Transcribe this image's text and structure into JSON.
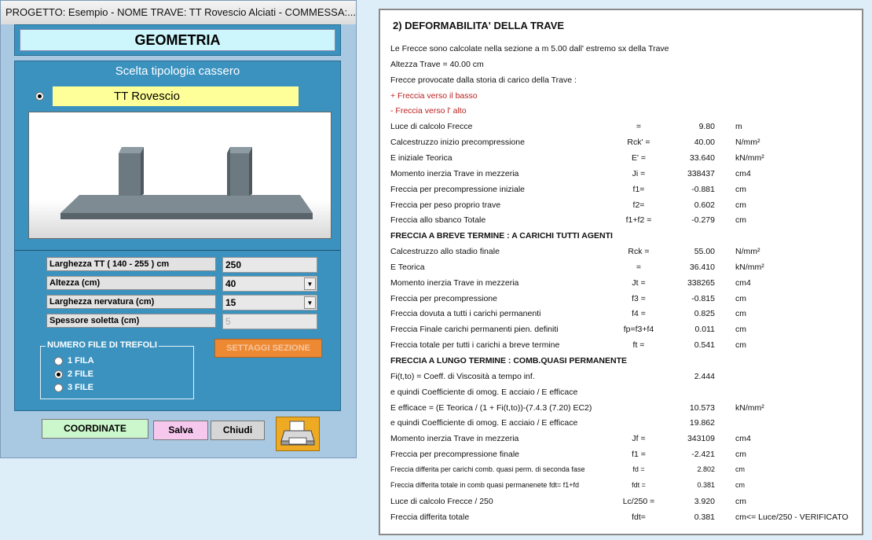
{
  "window": {
    "title": "PROGETTO: Esempio - NOME TRAVE: TT Rovescio Alciati - COMMESSA:..."
  },
  "geometry_panel": {
    "title": "GEOMETRIA",
    "cassero_label": "Scelta tipologia cassero",
    "selected_type": "TT Rovescio"
  },
  "fields": [
    {
      "label": "Larghezza TT ( 140 - 255 ) cm",
      "value": "250",
      "dropdown": false,
      "disabled": false
    },
    {
      "label": "Altezza (cm)",
      "value": "40",
      "dropdown": true,
      "disabled": false
    },
    {
      "label": "Larghezza nervatura (cm)",
      "value": "15",
      "dropdown": true,
      "disabled": false
    },
    {
      "label": "Spessore soletta (cm)",
      "value": "5",
      "dropdown": false,
      "disabled": true
    }
  ],
  "trefoli": {
    "title": "NUMERO FILE DI TREFOLI",
    "options": [
      "1 FILA",
      "2 FILE",
      "3 FILE"
    ],
    "selected": "2 FILE"
  },
  "buttons": {
    "settaggi": "SETTAGGI SEZIONE",
    "coordinate": "COORDINATE",
    "salva": "Salva",
    "chiudi": "Chiudi"
  },
  "report": {
    "title": "2) DEFORMABILITA' DELLA TRAVE",
    "rows": [
      {
        "label": "Le Frecce sono calcolate nella sezione a m 5.00 dall' estremo sx della Trave"
      },
      {
        "label": "Altezza Trave  = 40.00 cm"
      },
      {
        "label": "Frecce provocate dalla storia di carico della Trave :"
      },
      {
        "label": " +  Freccia verso il basso",
        "style": "red"
      },
      {
        "label": " -  Freccia verso l' alto",
        "style": "red"
      },
      {
        "label": "Luce di calcolo Frecce",
        "sym": "=",
        "value": "9.80",
        "unit": "m"
      },
      {
        "label": "Calcestruzzo inizio precompressione",
        "sym": "Rck' =",
        "value": "40.00",
        "unit": "N/mm²"
      },
      {
        "label": "E iniziale Teorica",
        "sym": "E' =",
        "value": "33.640",
        "unit": "kN/mm²"
      },
      {
        "label": "Momento inerzia Trave in mezzeria",
        "sym": "Ji =",
        "value": "338437",
        "unit": "cm4"
      },
      {
        "label": "Freccia per precompressione iniziale",
        "sym": "f1=",
        "value": "-0.881",
        "unit": "cm"
      },
      {
        "label": "Freccia per peso proprio trave",
        "sym": "f2=",
        "value": "0.602",
        "unit": "cm"
      },
      {
        "label": "Freccia  allo sbanco Totale",
        "sym": "f1+f2 =",
        "value": "-0.279",
        "unit": "cm"
      },
      {
        "label": "FRECCIA A BREVE TERMINE : A CARICHI TUTTI AGENTI",
        "style": "bold"
      },
      {
        "label": "Calcestruzzo allo stadio finale",
        "sym": "Rck =",
        "value": "55.00",
        "unit": "N/mm²"
      },
      {
        "label": "E Teorica",
        "sym": "=",
        "value": "36.410",
        "unit": "kN/mm²"
      },
      {
        "label": "Momento inerzia Trave in mezzeria",
        "sym": "Jt =",
        "value": "338265",
        "unit": "cm4"
      },
      {
        "label": "Freccia per precompressione",
        "sym": "f3 =",
        "value": "-0.815",
        "unit": "cm"
      },
      {
        "label": "Freccia dovuta a tutti i carichi permanenti",
        "sym": "f4 =",
        "value": "0.825",
        "unit": "cm"
      },
      {
        "label": "Freccia  Finale carichi permanenti pien. definiti",
        "sym": "fp=f3+f4",
        "value": "0.011",
        "unit": "cm"
      },
      {
        "label": "Freccia totale per tutti i carichi a breve termine",
        "sym": "ft =",
        "value": "0.541",
        "unit": "cm"
      },
      {
        "label": "FRECCIA A LUNGO TERMINE : COMB.QUASI PERMANENTE",
        "style": "bold"
      },
      {
        "label": "Fi(t,to) = Coeff. di Viscosità a tempo inf.",
        "value": "2.444"
      },
      {
        "label": "e quindi Coefficiente di omog. E acciaio / E efficace"
      },
      {
        "label": "E efficace = (E Teorica / (1 + Fi(t,to))-(7.4.3 (7.20) EC2)",
        "value": "10.573",
        "unit": "kN/mm²"
      },
      {
        "label": "e quindi Coefficiente di omog. E acciaio / E efficace",
        "value": "19.862"
      },
      {
        "label": "Momento inerzia Trave in mezzeria",
        "sym": "Jf =",
        "value": "343109",
        "unit": "cm4"
      },
      {
        "label": "Freccia per precompressione finale",
        "sym": "f1 =",
        "value": "-2.421",
        "unit": "cm"
      },
      {
        "label": "Freccia differita per carichi  comb. quasi perm. di seconda fase",
        "sym": "fd =",
        "value": "2.802",
        "unit": "cm",
        "style": "small"
      },
      {
        "label": "Freccia differita totale in comb quasi permanenete fdt= f1+fd",
        "sym": "fdt =",
        "value": "0.381",
        "unit": "cm",
        "style": "small"
      },
      {
        "label": "Luce di calcolo Frecce / 250",
        "sym": "Lc/250 =",
        "value": "3.920",
        "unit": "cm"
      },
      {
        "label": "Freccia differita totale",
        "sym": "fdt=",
        "value": "0.381",
        "unit": "cm<= Luce/250 - VERIFICATO"
      }
    ]
  },
  "icons": {
    "print": "printer-icon",
    "dropdown": "chevron-down-icon"
  },
  "colors": {
    "panel_blue": "#3b92bf",
    "window_bg": "#a9c9e2",
    "title_box": "#ccf6fb",
    "selected_type_bg": "#ffff99",
    "settaggi_orange": "#ee8933",
    "report_red": "#bb1e1e"
  }
}
